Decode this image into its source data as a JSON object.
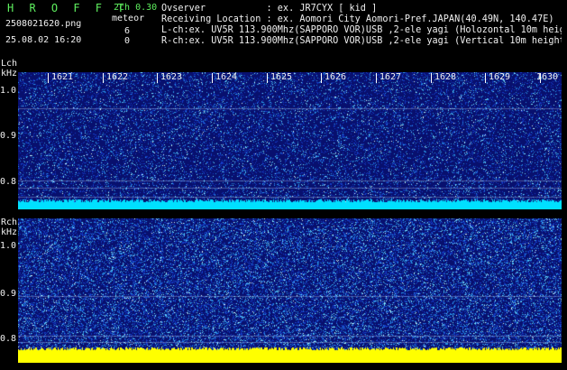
{
  "header": {
    "brand": "H R O F F T",
    "version": "2ch 0.30",
    "filename": "250802162​0.png",
    "meteor_label": "meteor",
    "lch_count": "6",
    "rch_count": "0",
    "datetime": "25.08.02 16:20",
    "observer": "Ovserver           : ex. JR7CYX [ kid ]",
    "location": "Receiving Location : ex. Aomori City Aomori-Pref.JAPAN(40.49N, 140.47E)",
    "lch_info": "L-ch:ex. UV5R 113.900Mhz(SAPPORO VOR)USB ,2-ele yagi (Holozontal 10m height)",
    "rch_info": "R-ch:ex. UV5R 113.900Mhz(SAPPORO VOR)USB ,2-ele yagi (Vertical 10m height)"
  },
  "lch_panel": {
    "channel_label": "Lch",
    "unit_label": "kHz",
    "y_ticks": [
      "1.0",
      "0.9",
      "0.8"
    ],
    "time_ticks": [
      "1621",
      "1622",
      "1623",
      "1624",
      "1625",
      "1626",
      "1627",
      "1628",
      "1629",
      "1630"
    ],
    "band_color": "#00e0ff"
  },
  "rch_panel": {
    "channel_label": "Rch",
    "unit_label": "kHz",
    "y_ticks": [
      "1.0",
      "0.9",
      "0.8"
    ],
    "band_color": "#ffff00"
  },
  "colors": {
    "header_green": "#5ff05f",
    "background": "#000000",
    "noise_base": "#0a1a8c",
    "noise_hot": "#00e0ff"
  }
}
